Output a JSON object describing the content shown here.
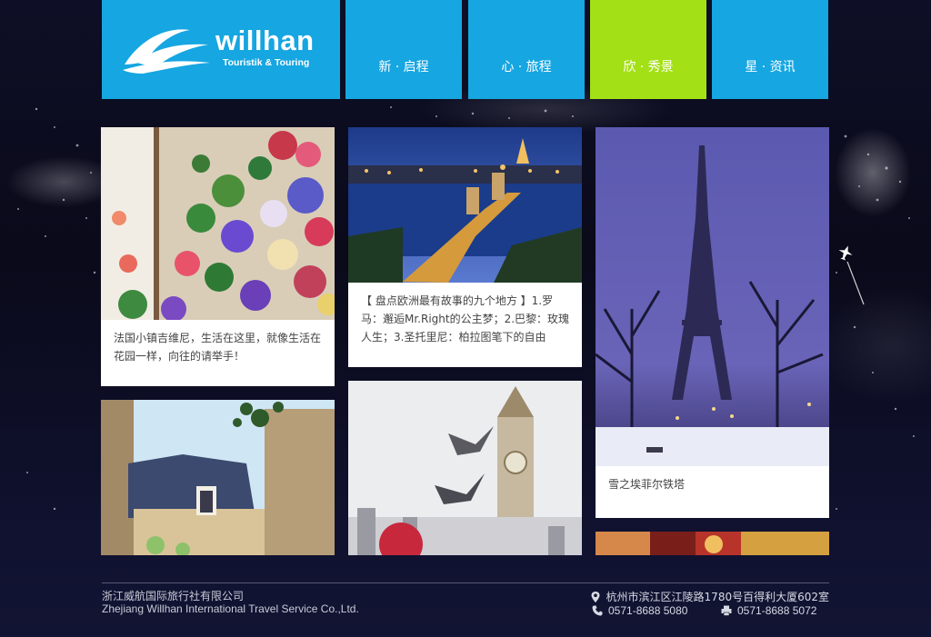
{
  "brand": {
    "name": "willhan",
    "tagline": "Touristik & Touring"
  },
  "nav": {
    "items": [
      {
        "label": "新 · 启程",
        "active": false
      },
      {
        "label": "心 · 旅程",
        "active": false
      },
      {
        "label": "欣 · 秀景",
        "active": true
      },
      {
        "label": "星 · 资讯",
        "active": false
      }
    ],
    "active_color": "#a3e015",
    "base_color": "#16a6e1"
  },
  "cards": {
    "flowers": {
      "image": "flower-wall-photo",
      "caption": "法国小镇吉维尼，生活在这里，就像生活在花园一样，向往的请举手！"
    },
    "budapest": {
      "image": "chain-bridge-night-photo",
      "caption": "【 盘点欧洲最有故事的九个地方 】1.罗马：邂逅Mr.Right的公主梦；2.巴黎：玫瑰人生；3.圣托里尼：柏拉图笔下的自由"
    },
    "eiffel": {
      "image": "eiffel-tower-snow-photo",
      "caption": "雪之埃菲尔铁塔"
    },
    "chateau": {
      "image": "stone-house-photo"
    },
    "london": {
      "image": "big-ben-seagulls-photo"
    },
    "market": {
      "image": "market-lights-photo"
    }
  },
  "footer": {
    "company_cn": "浙江威航国际旅行社有限公司",
    "company_en": "Zhejiang Willhan International Travel Service Co.,Ltd.",
    "address": "杭州市滨江区江陵路1780号百得利大厦602室",
    "phone": "0571-8688 5080",
    "fax": "0571-8688 5072"
  }
}
